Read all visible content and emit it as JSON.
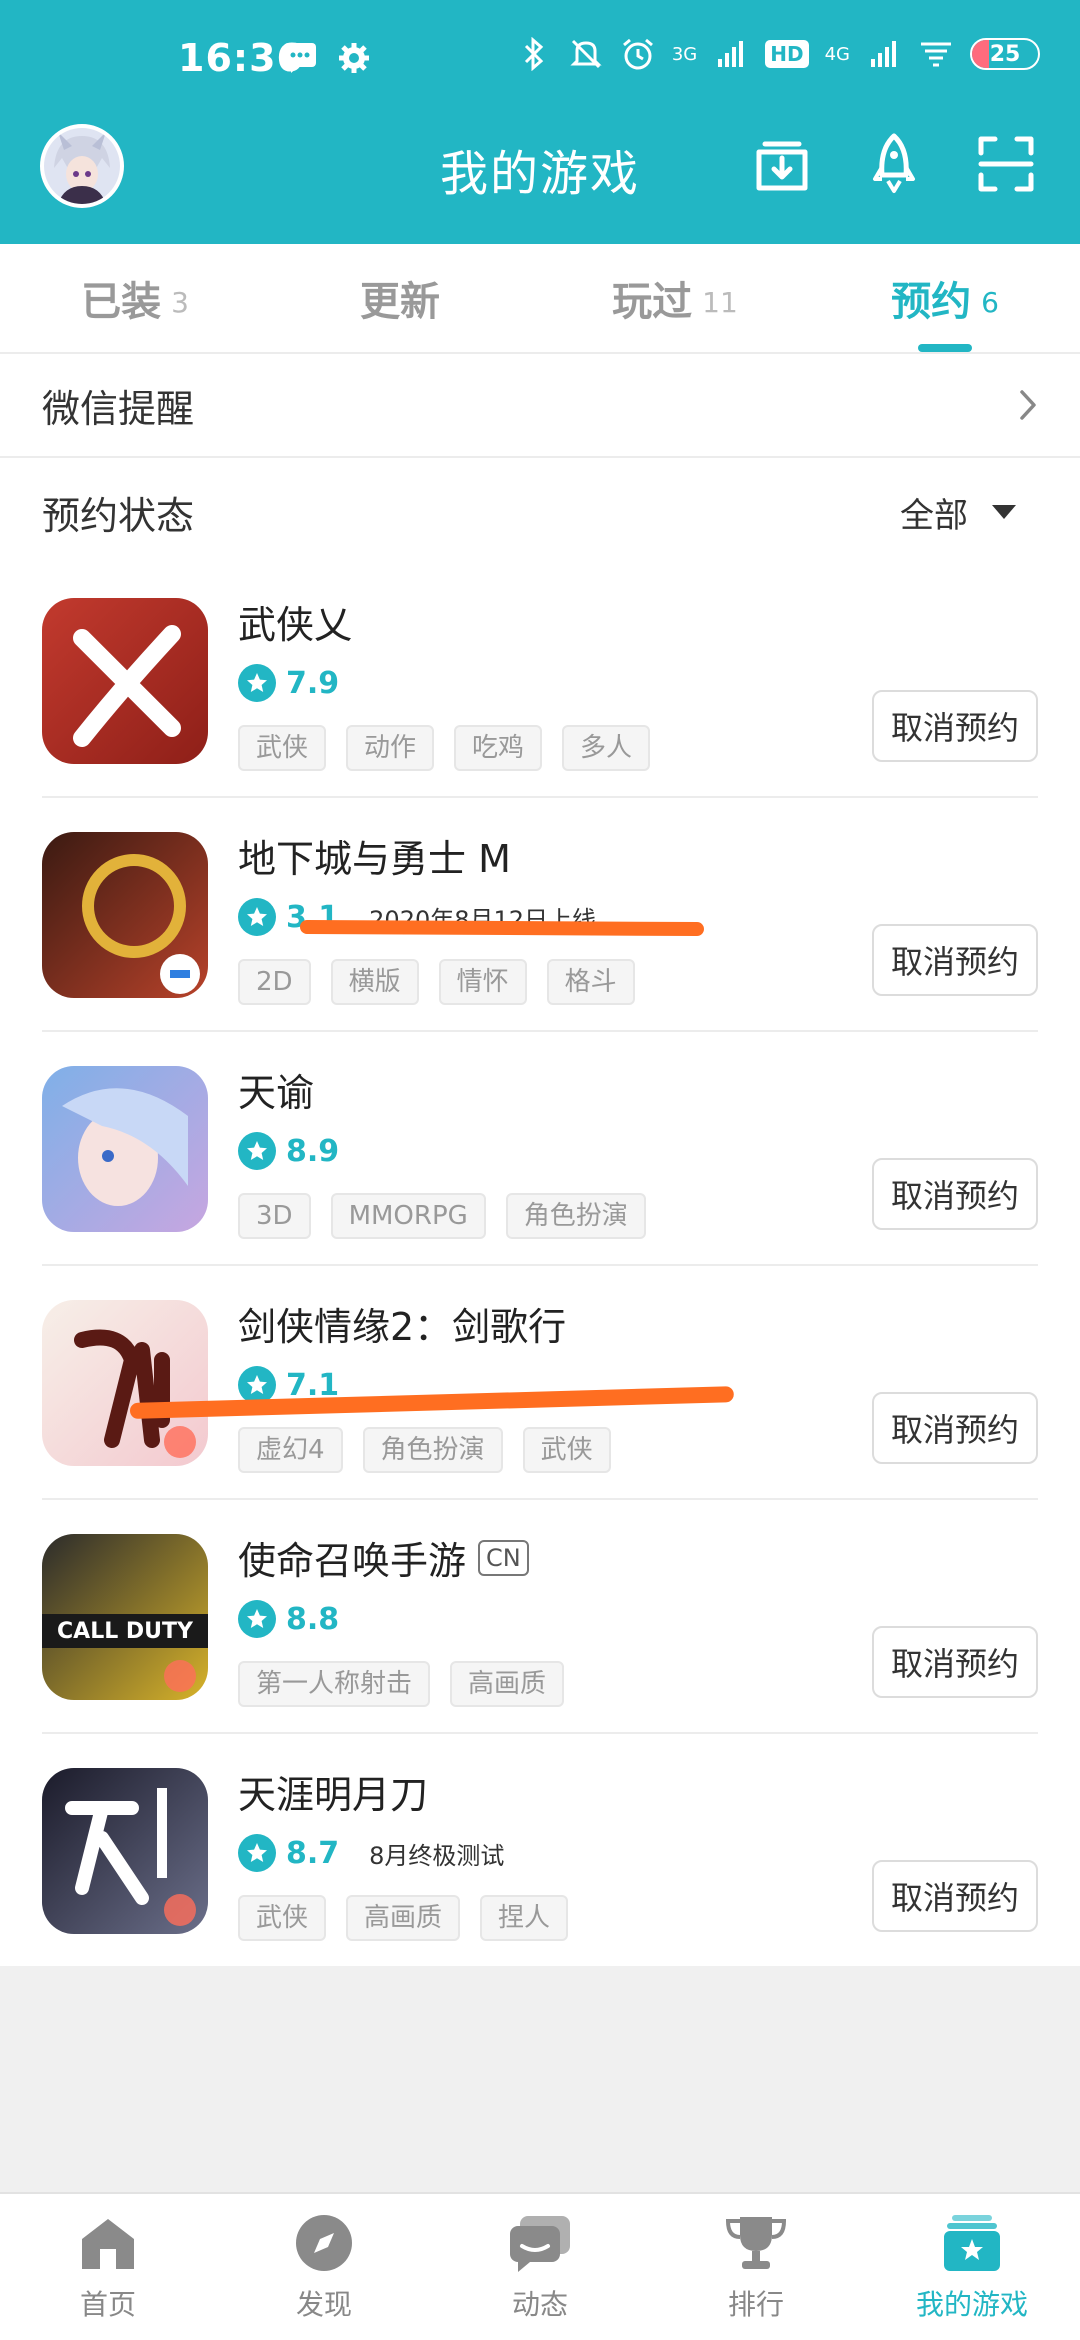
{
  "status_bar": {
    "time": "16:36",
    "network_a": "3G",
    "network_b": "4G",
    "hd": "HD",
    "battery_text": "25",
    "battery_level": 0.25
  },
  "header": {
    "title": "我的游戏",
    "accent_color": "#22b6c4",
    "actions": [
      "download-icon",
      "rocket-icon",
      "scan-icon"
    ]
  },
  "tabs": [
    {
      "label": "已装",
      "count": "3",
      "active": false
    },
    {
      "label": "更新",
      "count": "",
      "active": false
    },
    {
      "label": "玩过",
      "count": "11",
      "active": false
    },
    {
      "label": "预约",
      "count": "6",
      "active": true
    }
  ],
  "wechat_reminder": {
    "label": "微信提醒"
  },
  "filter": {
    "label": "预约状态",
    "selected": "全部"
  },
  "games": [
    {
      "name": "武侠乂",
      "region": "",
      "rating": "7.9",
      "note": "",
      "tags": [
        "武侠",
        "动作",
        "吃鸡",
        "多人"
      ],
      "button": "取消预约",
      "icon_colors": [
        "#c23a2e",
        "#8e1f18"
      ],
      "icon_glyph": "乂"
    },
    {
      "name": "地下城与勇士 M",
      "region": "",
      "rating": "3.1",
      "note": "2020年8月12日上线",
      "tags": [
        "2D",
        "横版",
        "情怀",
        "格斗"
      ],
      "button": "取消预约",
      "icon_colors": [
        "#3a1a12",
        "#b8422a"
      ],
      "icon_glyph": "DNF"
    },
    {
      "name": "天谕",
      "region": "",
      "rating": "8.9",
      "note": "",
      "tags": [
        "3D",
        "MMORPG",
        "角色扮演"
      ],
      "button": "取消预约",
      "icon_colors": [
        "#7fb0e8",
        "#c7a6e0"
      ],
      "icon_glyph": ""
    },
    {
      "name": "剑侠情缘2：剑歌行",
      "region": "",
      "rating": "7.1",
      "note": "",
      "tags": [
        "虚幻4",
        "角色扮演",
        "武侠"
      ],
      "button": "取消预约",
      "icon_colors": [
        "#f7efe8",
        "#f3c9cf"
      ],
      "icon_glyph": "剑"
    },
    {
      "name": "使命召唤手游",
      "region": "CN",
      "rating": "8.8",
      "note": "",
      "tags": [
        "第一人称射击",
        "高画质"
      ],
      "button": "取消预约",
      "icon_colors": [
        "#2b2b2b",
        "#d8b32a"
      ],
      "icon_glyph": "CALL DUTY"
    },
    {
      "name": "天涯明月刀",
      "region": "",
      "rating": "8.7",
      "note": "8月终极测试",
      "tags": [
        "武侠",
        "高画质",
        "捏人"
      ],
      "button": "取消预约",
      "icon_colors": [
        "#1b1b2a",
        "#6b6f8a"
      ],
      "icon_glyph": "天涯"
    }
  ],
  "bottom_nav": [
    {
      "label": "首页",
      "icon": "home-icon",
      "active": false
    },
    {
      "label": "发现",
      "icon": "compass-icon",
      "active": false
    },
    {
      "label": "动态",
      "icon": "chat-icon",
      "active": false
    },
    {
      "label": "排行",
      "icon": "trophy-icon",
      "active": false
    },
    {
      "label": "我的游戏",
      "icon": "my-games-icon",
      "active": true
    }
  ]
}
